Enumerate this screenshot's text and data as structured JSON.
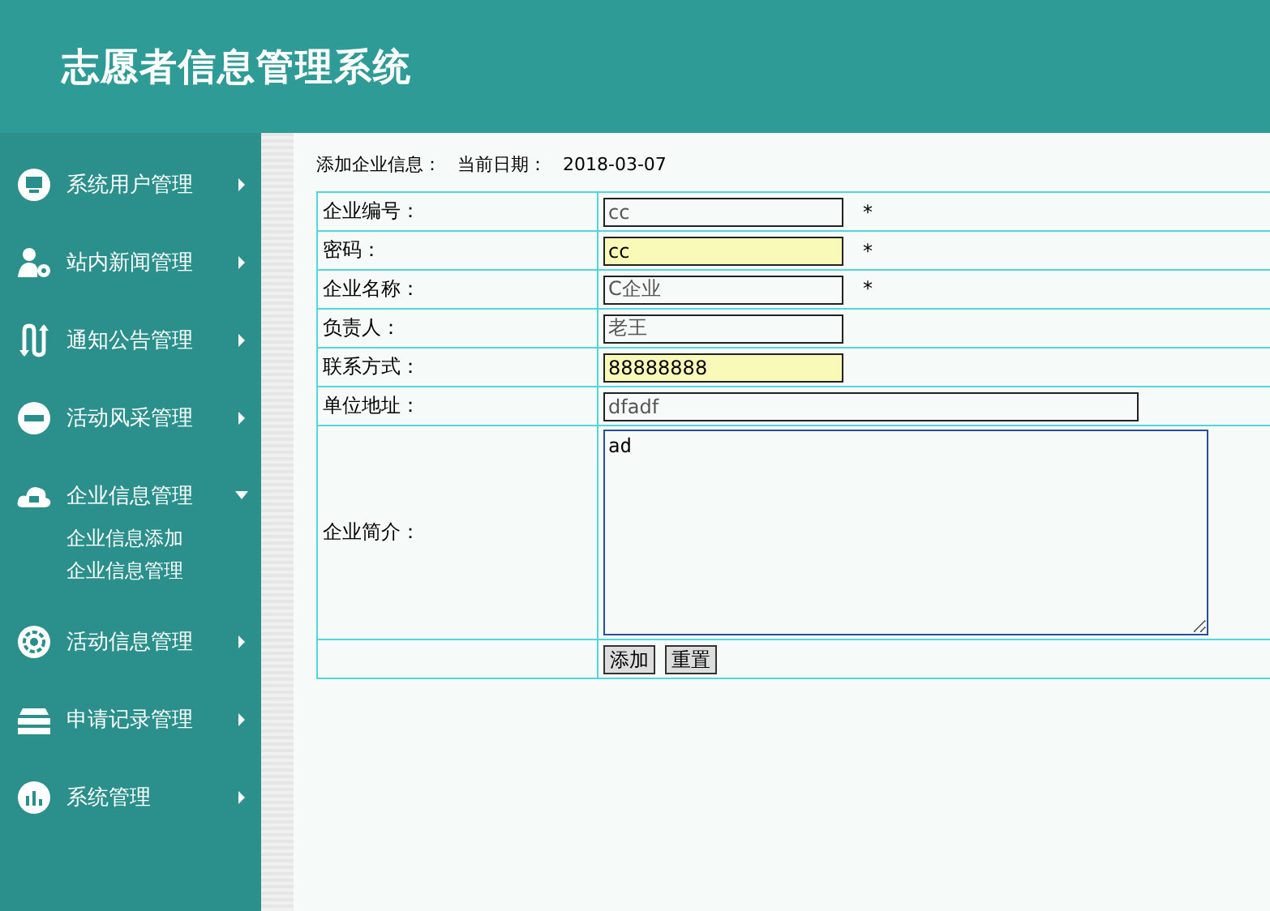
{
  "header": {
    "title": "志愿者信息管理系统"
  },
  "sidebar": {
    "items": [
      {
        "label": "系统用户管理",
        "expanded": false
      },
      {
        "label": "站内新闻管理",
        "expanded": false
      },
      {
        "label": "通知公告管理",
        "expanded": false
      },
      {
        "label": "活动风采管理",
        "expanded": false
      },
      {
        "label": "企业信息管理",
        "expanded": true,
        "children": [
          {
            "label": "企业信息添加"
          },
          {
            "label": "企业信息管理"
          }
        ]
      },
      {
        "label": "活动信息管理",
        "expanded": false
      },
      {
        "label": "申请记录管理",
        "expanded": false
      },
      {
        "label": "系统管理",
        "expanded": false
      }
    ]
  },
  "page": {
    "heading": "添加企业信息：",
    "date_label": "当前日期：",
    "date": "2018-03-07"
  },
  "form": {
    "rows": [
      {
        "kind": "input",
        "label": "企业编号：",
        "value": "cc",
        "highlighted": false,
        "required": true,
        "wide": false
      },
      {
        "kind": "input",
        "label": "密码：",
        "value": "cc",
        "highlighted": true,
        "required": true,
        "wide": false
      },
      {
        "kind": "input",
        "label": "企业名称：",
        "value": "C企业",
        "highlighted": false,
        "required": true,
        "wide": false
      },
      {
        "kind": "input",
        "label": "负责人：",
        "value": "老王",
        "highlighted": false,
        "required": false,
        "wide": false
      },
      {
        "kind": "input",
        "label": "联系方式：",
        "value": "88888888",
        "highlighted": true,
        "required": false,
        "wide": false
      },
      {
        "kind": "input",
        "label": "单位地址：",
        "value": "dfadf",
        "highlighted": false,
        "required": false,
        "wide": true
      },
      {
        "kind": "textarea",
        "label": "企业简介：",
        "value": "ad"
      }
    ],
    "required_mark": "*",
    "buttons": [
      "添加",
      "重置"
    ]
  }
}
